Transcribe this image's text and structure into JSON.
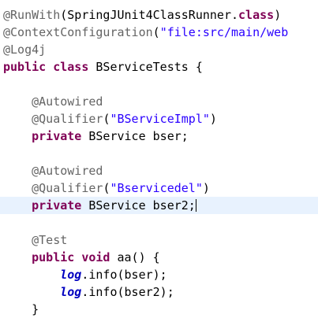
{
  "lines": [
    [
      "@RunWith",
      "(SpringJUnit4ClassRunner.",
      "class",
      ")"
    ],
    [
      "@ContextConfiguration",
      "(",
      "\"file:src/main/web"
    ],
    [
      "@Log4j"
    ],
    [
      "public",
      "class",
      "BServiceTests {"
    ],
    [],
    [
      "@Autowired"
    ],
    [
      "@Qualifier",
      "(",
      "\"BServiceImpl\"",
      ")"
    ],
    [
      "private",
      "BService bser;"
    ],
    [],
    [
      "@Autowired"
    ],
    [
      "@Qualifier",
      "(",
      "\"Bservicedel\"",
      ")"
    ],
    [
      "private",
      "BService bser2;"
    ],
    [],
    [
      "@Test"
    ],
    [
      "public",
      "void",
      "aa() {"
    ],
    [
      "log",
      ".info(bser);"
    ],
    [
      "log",
      ".info(bser2);"
    ],
    [
      "}"
    ]
  ]
}
